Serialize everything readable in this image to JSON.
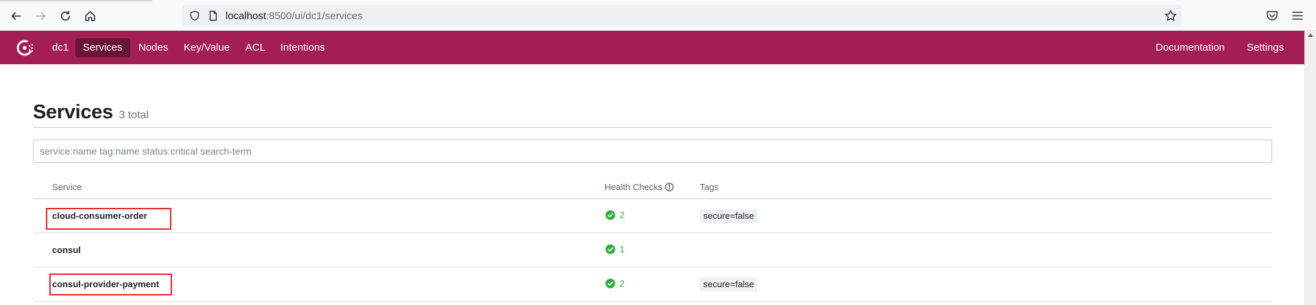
{
  "browser": {
    "url_host": "localhost",
    "url_path": ":8500/ui/dc1/services"
  },
  "header": {
    "datacenter": "dc1",
    "nav": {
      "services": "Services",
      "nodes": "Nodes",
      "key_value": "Key/Value",
      "acl": "ACL",
      "intentions": "Intentions"
    },
    "right": {
      "documentation": "Documentation",
      "settings": "Settings"
    },
    "brand_color": "#a21e55",
    "active_color": "#6a1437"
  },
  "main": {
    "title": "Services",
    "count": "3 total",
    "search": {
      "value": "",
      "placeholder": "service:name tag:name status:critical search-term"
    },
    "columns": {
      "service": "Service",
      "health_checks": "Health Checks",
      "tags": "Tags"
    },
    "rows": [
      {
        "name": "cloud-consumer-order",
        "checks": "2",
        "tag": "secure=false",
        "highlighted": true
      },
      {
        "name": "consul",
        "checks": "1",
        "tag": "",
        "highlighted": false
      },
      {
        "name": "consul-provider-payment",
        "checks": "2",
        "tag": "secure=false",
        "highlighted": true
      }
    ],
    "status_color": "#2eb039",
    "highlight_color": "#e0242a"
  },
  "icons": {
    "back": "arrow-left-icon",
    "forward": "arrow-right-icon",
    "reload": "reload-icon",
    "home": "home-icon",
    "shield": "shield-icon",
    "page": "page-icon",
    "bookmark": "star-icon",
    "pocket": "pocket-icon",
    "menu": "hamburger-menu-icon",
    "logo": "consul-logo",
    "info": "info-icon",
    "check": "check-circle-icon"
  }
}
